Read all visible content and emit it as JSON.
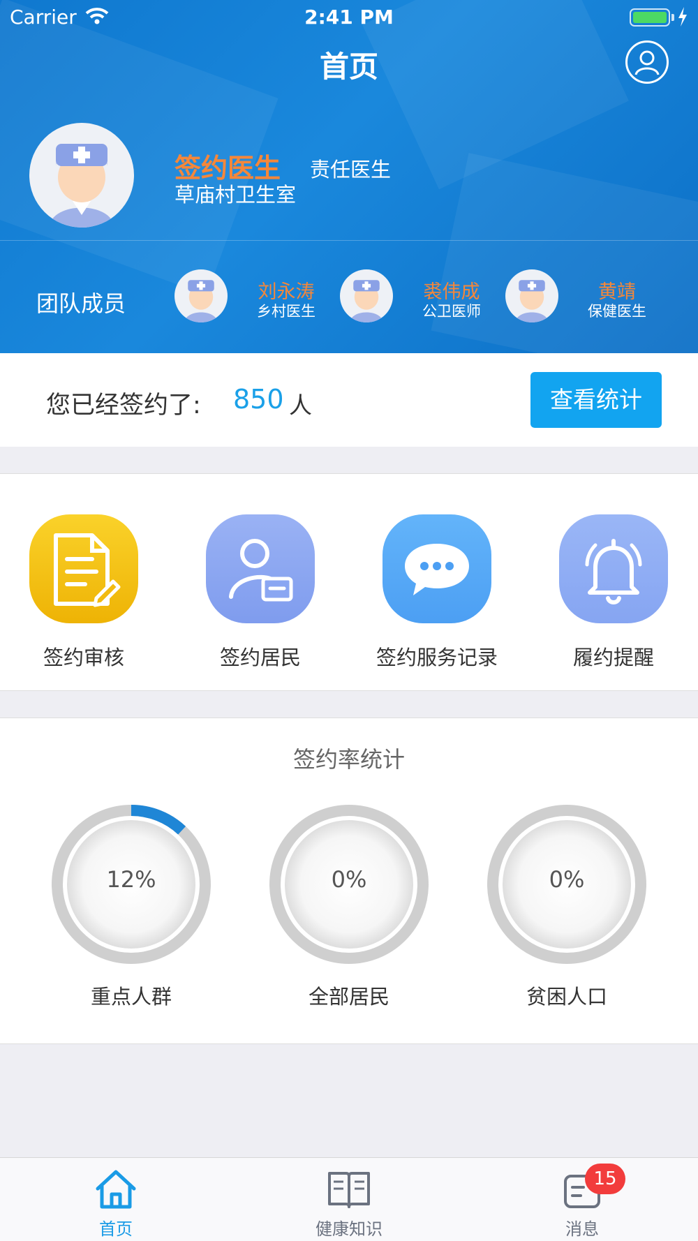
{
  "status_bar": {
    "carrier": "Carrier",
    "time": "2:41 PM"
  },
  "header": {
    "title": "首页",
    "doctor": {
      "role": "签约医生",
      "title": "责任医生",
      "org": "草庙村卫生室"
    },
    "team_label": "团队成员",
    "members": [
      {
        "name": "刘永涛",
        "role": "乡村医生"
      },
      {
        "name": "裘伟成",
        "role": "公卫医师"
      },
      {
        "name": "黄靖",
        "role": "保健医生"
      }
    ]
  },
  "signed": {
    "label": "您已经签约了:",
    "count": "850",
    "unit": "人",
    "button": "查看统计"
  },
  "menu": [
    {
      "label": "签约审核",
      "icon": "document-edit-icon",
      "color": "#f2bb10"
    },
    {
      "label": "签约居民",
      "icon": "resident-card-icon",
      "color": "#8aa6f2"
    },
    {
      "label": "签约服务记录",
      "icon": "chat-bubble-icon",
      "color": "#5aaaf7"
    },
    {
      "label": "履约提醒",
      "icon": "bell-icon",
      "color": "#8faef5"
    }
  ],
  "stats": {
    "title": "签约率统计",
    "gauges": [
      {
        "label": "重点人群",
        "percent_text": "12%",
        "value": 0.12
      },
      {
        "label": "全部居民",
        "percent_text": "0%",
        "value": 0
      },
      {
        "label": "贫困人口",
        "percent_text": "0%",
        "value": 0
      }
    ]
  },
  "tabbar": {
    "tabs": [
      {
        "label": "首页",
        "active": true
      },
      {
        "label": "健康知识",
        "active": false
      },
      {
        "label": "消息",
        "active": false,
        "badge": "15"
      }
    ],
    "active_color": "#1a9be6",
    "inactive_color": "#6b7280"
  }
}
